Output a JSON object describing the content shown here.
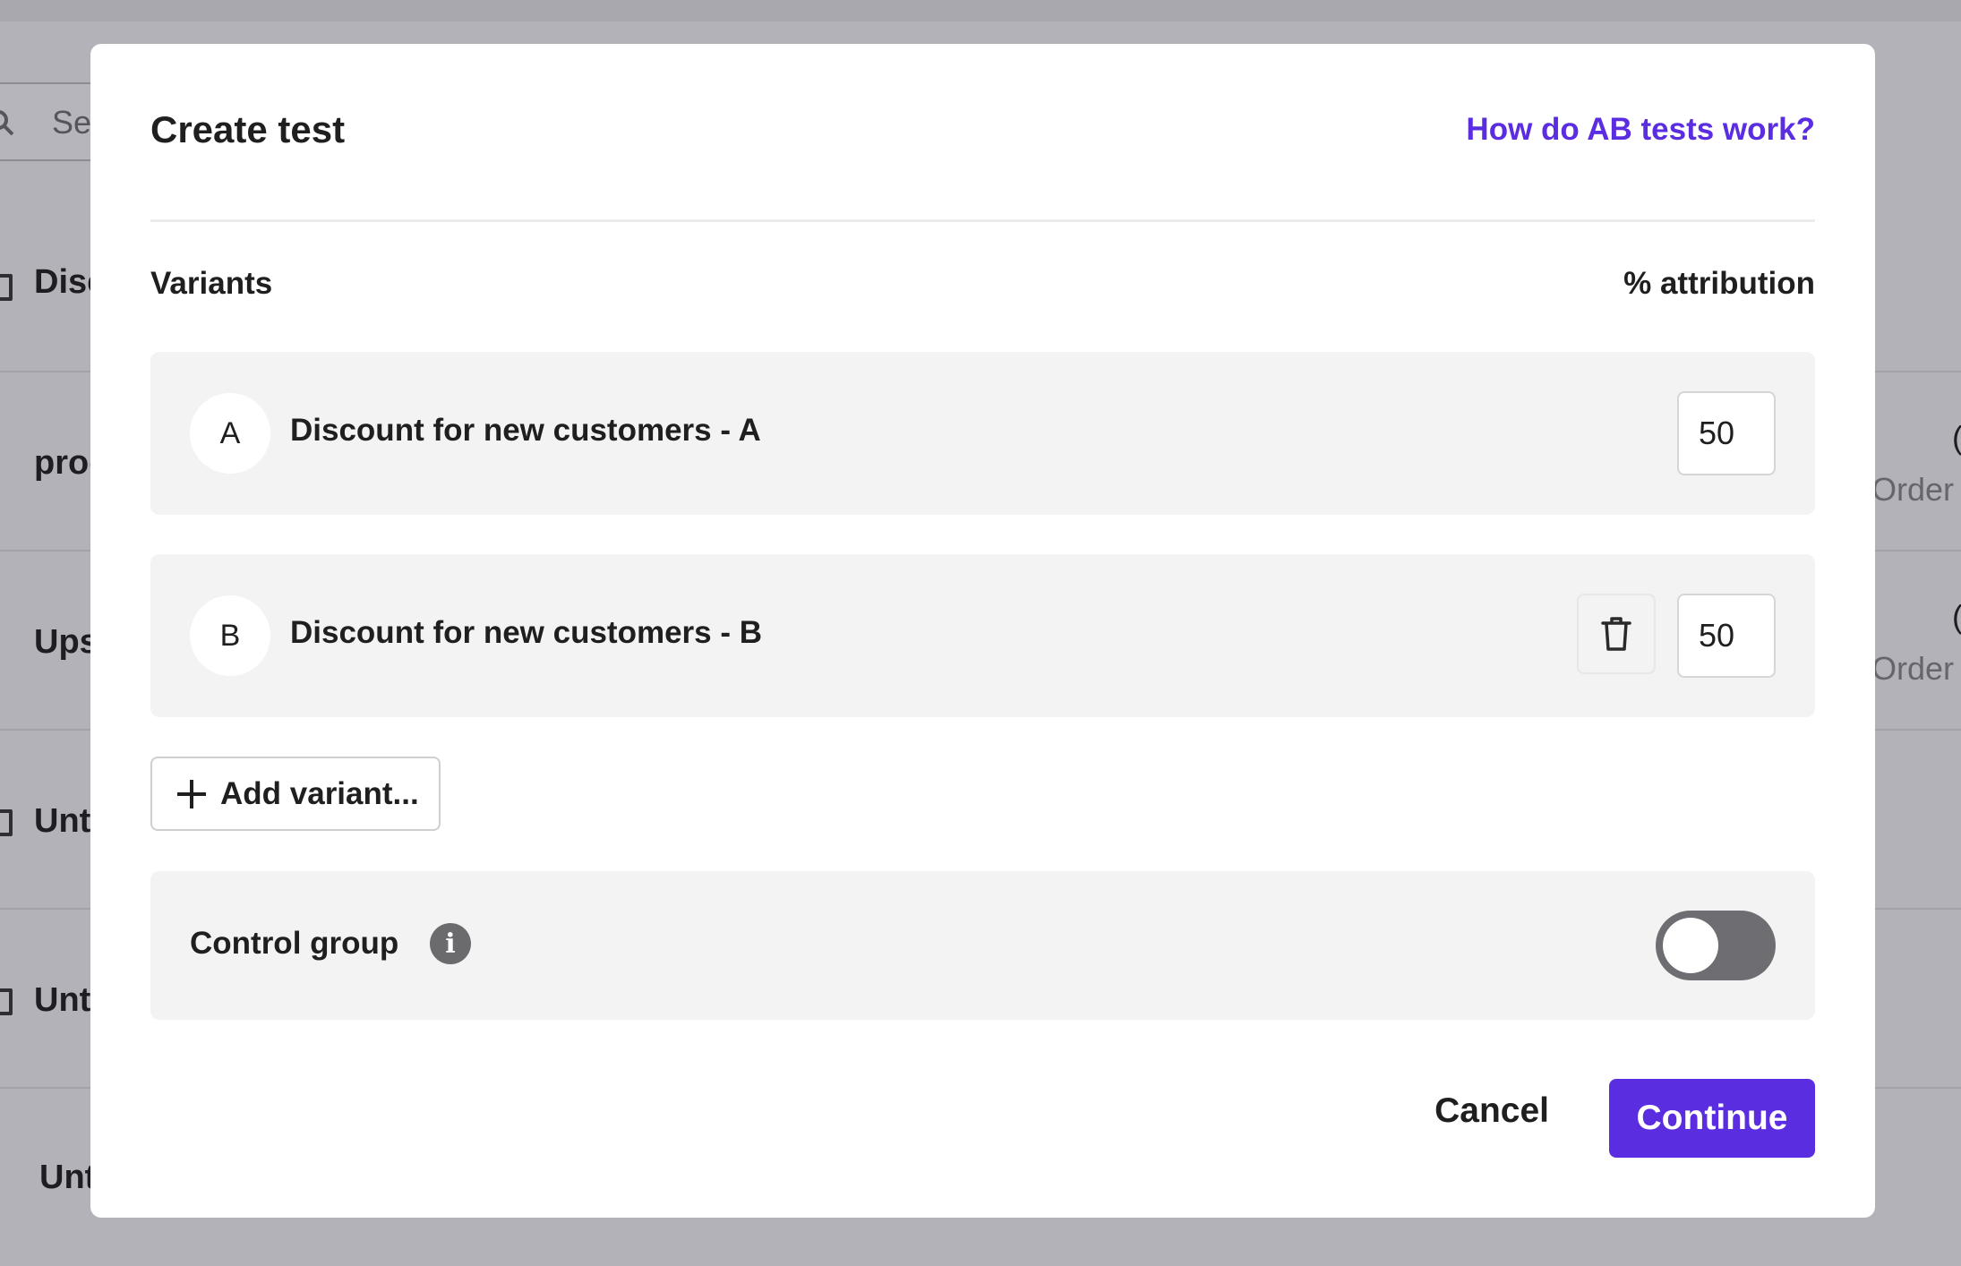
{
  "background": {
    "search_placeholder": "Se",
    "rows": [
      {
        "title": "Disc",
        "meta": "",
        "count": ""
      },
      {
        "title": "proc",
        "meta": "Order",
        "count": "("
      },
      {
        "title": "Ups",
        "meta": "Order",
        "count": "("
      },
      {
        "title": "Unt",
        "meta": "",
        "count": ""
      },
      {
        "title": "Unt",
        "meta": "",
        "count": ""
      },
      {
        "title": "Unt",
        "meta": "",
        "count": ""
      }
    ]
  },
  "modal": {
    "title": "Create test",
    "help_link": "How do AB tests work?",
    "variants_label": "Variants",
    "attribution_label": "% attribution",
    "variants": [
      {
        "letter": "A",
        "name": "Discount for new customers - A",
        "percent": "50",
        "deletable": false
      },
      {
        "letter": "B",
        "name": "Discount for new customers - B",
        "percent": "50",
        "deletable": true
      }
    ],
    "add_variant_label": "Add variant...",
    "control_group": {
      "label": "Control group",
      "enabled": false
    },
    "cancel_label": "Cancel",
    "continue_label": "Continue"
  },
  "colors": {
    "accent": "#5b2de0",
    "overlay": "#b3b2b8",
    "card": "#f3f3f3",
    "toggle_off": "#6e6e72"
  },
  "icons": {
    "search": "search-icon",
    "add": "plus-icon",
    "delete": "trash-icon",
    "info": "info-icon"
  }
}
